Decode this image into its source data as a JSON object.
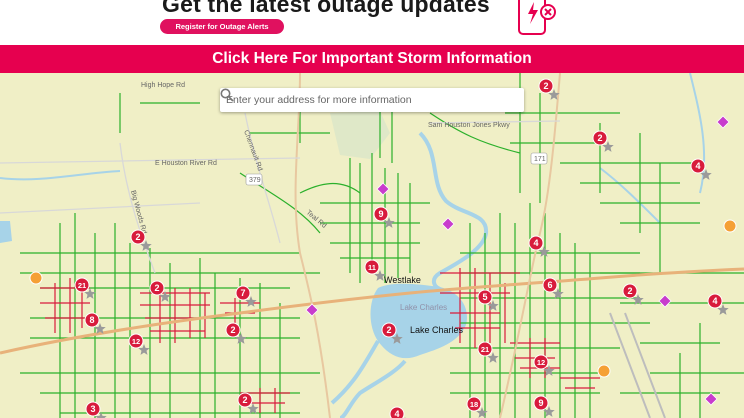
{
  "banner": {
    "headline": "Get the latest outage updates",
    "register_label": "Register for Outage Alerts",
    "storm_link": "Click Here For Important Storm Information"
  },
  "colors": {
    "brand": "#e6004f",
    "outage": "#d81b3c",
    "energized": "#2bb02b",
    "water": "#a7d3e8",
    "land": "#f0efc6"
  },
  "icons": [
    "alert-phone-icon",
    "search-icon",
    "outage-marker-icon",
    "diamond-marker-icon",
    "crew-marker-icon"
  ],
  "search": {
    "placeholder": "Enter your address for more information"
  },
  "map": {
    "roads": [
      "High Hope Rd",
      "E Houston River Rd",
      "Sam Houston Jones Pkwy",
      "Big Woods Rd",
      "Chennault Rd",
      "Teal Rd"
    ],
    "highways": [
      "379",
      "171"
    ],
    "cities": [
      "Westlake",
      "Lake Charles"
    ],
    "water": [
      "Lake Charles"
    ],
    "outages": [
      {
        "count": "2"
      },
      {
        "count": "2"
      },
      {
        "count": "4"
      },
      {
        "count": "9"
      },
      {
        "count": "2"
      },
      {
        "count": "4"
      },
      {
        "count": "11"
      },
      {
        "count": "21"
      },
      {
        "count": "2"
      },
      {
        "count": "7"
      },
      {
        "count": "8"
      },
      {
        "count": "2"
      },
      {
        "count": "12"
      },
      {
        "count": "5"
      },
      {
        "count": "6"
      },
      {
        "count": "2"
      },
      {
        "count": "2"
      },
      {
        "count": "4"
      },
      {
        "count": "21"
      },
      {
        "count": "12"
      },
      {
        "count": "3"
      },
      {
        "count": "2"
      },
      {
        "count": "18"
      },
      {
        "count": "9"
      },
      {
        "count": "4"
      }
    ]
  }
}
